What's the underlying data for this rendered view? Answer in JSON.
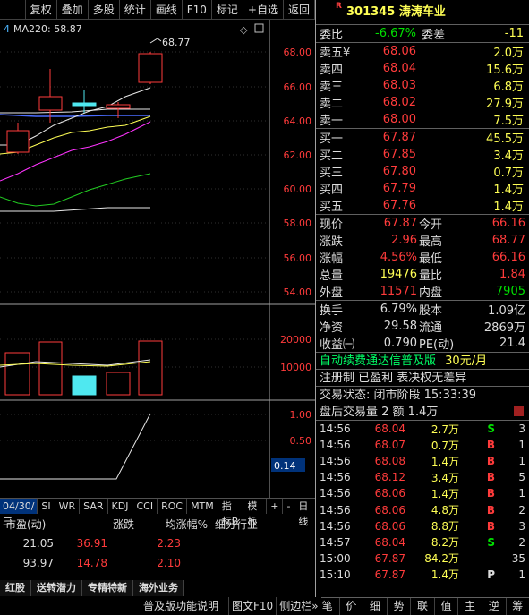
{
  "toolbar": {
    "items": [
      "复权",
      "叠加",
      "多股",
      "统计",
      "画线",
      "F10",
      "标记",
      "+自选",
      "返回"
    ]
  },
  "chart": {
    "ma_legend": "MA220: 58.87",
    "high_label": "68.77",
    "date_label": "04/30/三",
    "price_axis": [
      "68.00",
      "66.00",
      "64.00",
      "62.00",
      "60.00",
      "58.00",
      "56.00",
      "54.00"
    ],
    "volume_axis": [
      "20000",
      "10000"
    ],
    "indicator_axis": [
      "1.00",
      "0.50",
      "0.14"
    ],
    "indicator_tabs": [
      "SI",
      "WR",
      "SAR",
      "KDJ",
      "CCI",
      "ROC",
      "MTM"
    ],
    "indicator_b": "指标B",
    "template": "模 板",
    "plus": "+",
    "minus": "-",
    "period": "日线"
  },
  "lower_table": {
    "headers": [
      "市盈(动)",
      "涨跌",
      "均涨幅%",
      "细分行业"
    ],
    "rows": [
      {
        "pe": "21.05",
        "chg": "36.91",
        "avg": "2.23"
      },
      {
        "pe": "93.97",
        "chg": "14.78",
        "avg": "2.10"
      }
    ]
  },
  "bottom_tabs": [
    "红股",
    "送转潜力",
    "专精特新",
    "海外业务"
  ],
  "status_bar": "普及版功能说明",
  "quote": {
    "flag": "R",
    "code": "301345",
    "name": "涛涛车业",
    "weibi_label": "委比",
    "weibi": "-6.67%",
    "weicha_label": "委差",
    "weicha": "-11",
    "asks": [
      {
        "label": "卖五",
        "mark": "¥",
        "price": "68.06",
        "vol": "2.0万"
      },
      {
        "label": "卖四",
        "mark": "",
        "price": "68.04",
        "vol": "15.6万"
      },
      {
        "label": "卖三",
        "mark": "",
        "price": "68.03",
        "vol": "6.8万"
      },
      {
        "label": "卖二",
        "mark": "",
        "price": "68.02",
        "vol": "27.9万"
      },
      {
        "label": "卖一",
        "mark": "",
        "price": "68.00",
        "vol": "7.5万"
      }
    ],
    "bids": [
      {
        "label": "买一",
        "price": "67.87",
        "vol": "45.5万"
      },
      {
        "label": "买二",
        "price": "67.85",
        "vol": "3.4万"
      },
      {
        "label": "买三",
        "price": "67.80",
        "vol": "0.7万"
      },
      {
        "label": "买四",
        "price": "67.79",
        "vol": "1.4万"
      },
      {
        "label": "买五",
        "price": "67.76",
        "vol": "1.4万"
      }
    ],
    "stats": [
      {
        "k": "现价",
        "v": "67.87",
        "vc": "red",
        "k2": "今开",
        "v2": "66.16",
        "v2c": "red"
      },
      {
        "k": "涨跌",
        "v": "2.96",
        "vc": "red",
        "k2": "最高",
        "v2": "68.77",
        "v2c": "red"
      },
      {
        "k": "涨幅",
        "v": "4.56%",
        "vc": "red",
        "k2": "最低",
        "v2": "66.16",
        "v2c": "red"
      },
      {
        "k": "总量",
        "v": "19476",
        "vc": "yellow",
        "k2": "量比",
        "v2": "1.84",
        "v2c": "red"
      },
      {
        "k": "外盘",
        "v": "11571",
        "vc": "red",
        "k2": "内盘",
        "v2": "7905",
        "v2c": "green"
      }
    ],
    "stats2": [
      {
        "k": "换手",
        "v": "6.79%",
        "vc": "white",
        "k2": "股本",
        "v2": "1.09亿",
        "v2c": "white"
      },
      {
        "k": "净资",
        "v": "29.58",
        "vc": "white",
        "k2": "流通",
        "v2": "2869万",
        "v2c": "white"
      },
      {
        "k": "收益㈠",
        "v": "0.790",
        "vc": "white",
        "k2": "PE(动)",
        "v2": "21.4",
        "v2c": "white"
      }
    ],
    "ad_line": "自动续费通达信普及版",
    "ad_price": "30元/月",
    "tags": "注册制 已盈利 表决权无差异",
    "trade_status": "交易状态: 闭市阶段 15:33:39",
    "after_hours": "盘后交易量 2 额 1.4万",
    "ticks": [
      {
        "t": "14:56",
        "p": "68.04",
        "v": "2.7万",
        "bs": "S",
        "n": "3"
      },
      {
        "t": "14:56",
        "p": "68.07",
        "v": "0.7万",
        "bs": "B",
        "n": "1"
      },
      {
        "t": "14:56",
        "p": "68.08",
        "v": "1.4万",
        "bs": "B",
        "n": "1"
      },
      {
        "t": "14:56",
        "p": "68.12",
        "v": "3.4万",
        "bs": "B",
        "n": "5"
      },
      {
        "t": "14:56",
        "p": "68.06",
        "v": "1.4万",
        "bs": "B",
        "n": "1"
      },
      {
        "t": "14:56",
        "p": "68.06",
        "v": "4.8万",
        "bs": "B",
        "n": "2"
      },
      {
        "t": "14:56",
        "p": "68.06",
        "v": "8.8万",
        "bs": "B",
        "n": "3"
      },
      {
        "t": "14:57",
        "p": "68.04",
        "v": "8.2万",
        "bs": "S",
        "n": "2"
      },
      {
        "t": "15:00",
        "p": "67.87",
        "v": "84.2万",
        "bs": "",
        "n": "35"
      },
      {
        "t": "15:10",
        "p": "67.87",
        "v": "1.4万",
        "bs": "P",
        "n": "1"
      }
    ],
    "bottom": [
      "笔",
      "价",
      "细",
      "势",
      "联",
      "值",
      "主",
      "逆",
      "筹"
    ],
    "f10": "图文F10",
    "sidebar": "侧边栏»"
  },
  "colors": {
    "up": "#ff3b3b",
    "down": "#00e000",
    "volume_highlight": "#4fe8f0",
    "ma_white": "#e8e8e8",
    "ma_yellow": "#ffff55",
    "ma_magenta": "#ff33ff",
    "ma_green": "#22cc22",
    "ma_blue": "#4a6cff"
  }
}
